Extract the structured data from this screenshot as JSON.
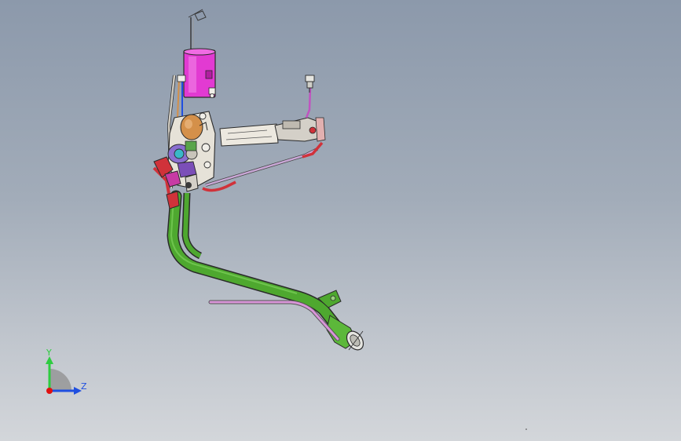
{
  "viewport": {
    "background_top": "#8c99ab",
    "background_bottom": "#d3d6da"
  },
  "model": {
    "colors": {
      "canister": "#e23ad2",
      "filler_tube": "#4ea82f",
      "vent_line": "#d895d8",
      "red_hose": "#d0323a",
      "orange_part": "#d4904a",
      "metal": "#d4d0c8",
      "outline": "#2a2a2a"
    }
  },
  "triad": {
    "y_label": "Y",
    "z_label": "Z",
    "y_color": "#2ecc40",
    "z_color": "#1f4fe0",
    "x_color": "#e01010"
  }
}
